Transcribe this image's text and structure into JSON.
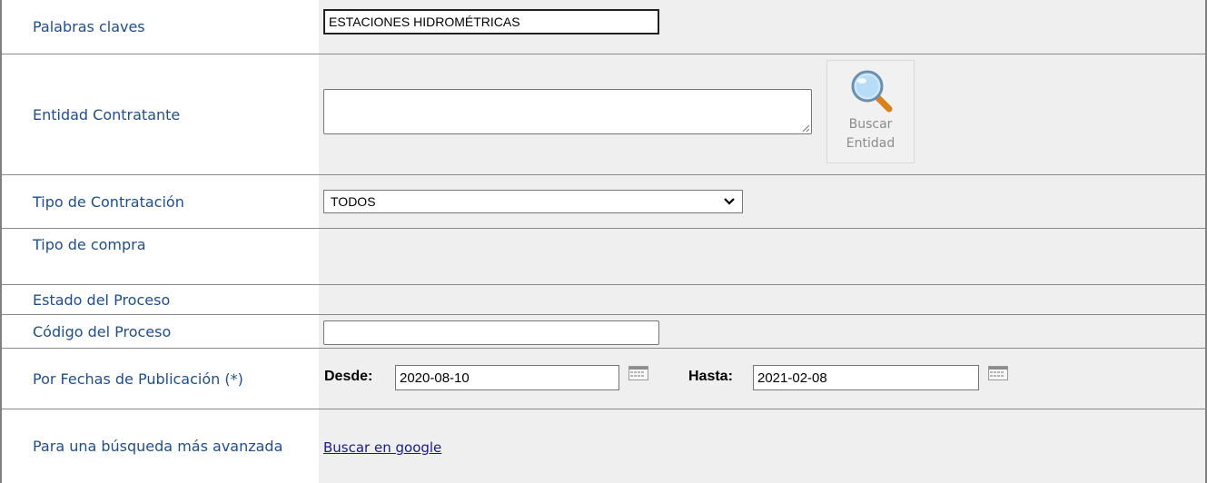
{
  "form": {
    "keywords": {
      "label": "Palabras claves",
      "value": "ESTACIONES HIDROMÉTRICAS"
    },
    "entity": {
      "label": "Entidad Contratante",
      "value": "",
      "search_button": "Buscar Entidad"
    },
    "contract_type": {
      "label": "Tipo de Contratación",
      "selected": "TODOS"
    },
    "purchase_type": {
      "label": "Tipo de compra"
    },
    "process_state": {
      "label": "Estado del Proceso"
    },
    "process_code": {
      "label": "Código del Proceso",
      "value": ""
    },
    "publication_dates": {
      "label": "Por Fechas de Publicación (*)",
      "from_label": "Desde:",
      "from_value": "2020-08-10",
      "to_label": "Hasta:",
      "to_value": "2021-02-08"
    },
    "advanced": {
      "label": "Para una búsqueda más avanzada",
      "link": "Buscar en google"
    }
  },
  "colors": {
    "label_text": "#1f4e8c",
    "value_bg": "#efefef",
    "link": "#1a1a8c"
  },
  "icons": {
    "entity_search": "magnifier-icon",
    "date_picker": "calendar-icon",
    "select_arrow": "chevron-down-icon"
  }
}
